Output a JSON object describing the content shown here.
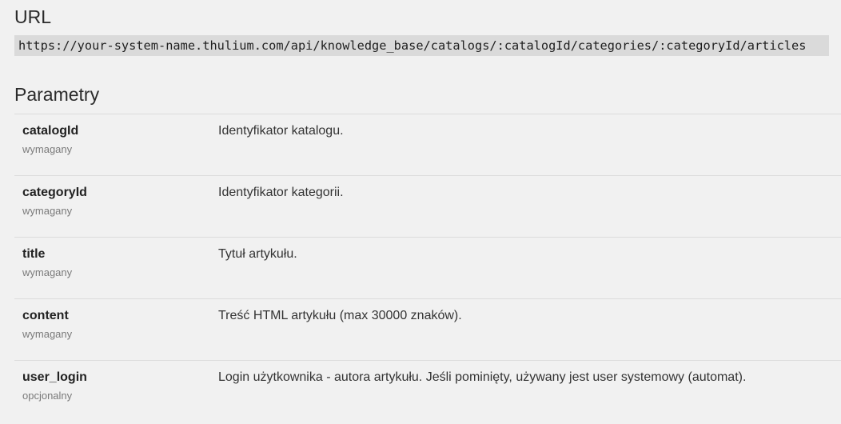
{
  "url_section": {
    "title": "URL",
    "url": "https://your-system-name.thulium.com/api/knowledge_base/catalogs/:catalogId/categories/:categoryId/articles"
  },
  "params_section": {
    "title": "Parametry",
    "params": [
      {
        "name": "catalogId",
        "requirement": "wymagany",
        "description": "Identyfikator katalogu."
      },
      {
        "name": "categoryId",
        "requirement": "wymagany",
        "description": "Identyfikator kategorii."
      },
      {
        "name": "title",
        "requirement": "wymagany",
        "description": "Tytuł artykułu."
      },
      {
        "name": "content",
        "requirement": "wymagany",
        "description": "Treść HTML artykułu (max 30000 znaków)."
      },
      {
        "name": "user_login",
        "requirement": "opcjonalny",
        "description": "Login użytkownika - autora artykułu. Jeśli pominięty, używany jest user systemowy (automat)."
      }
    ]
  }
}
